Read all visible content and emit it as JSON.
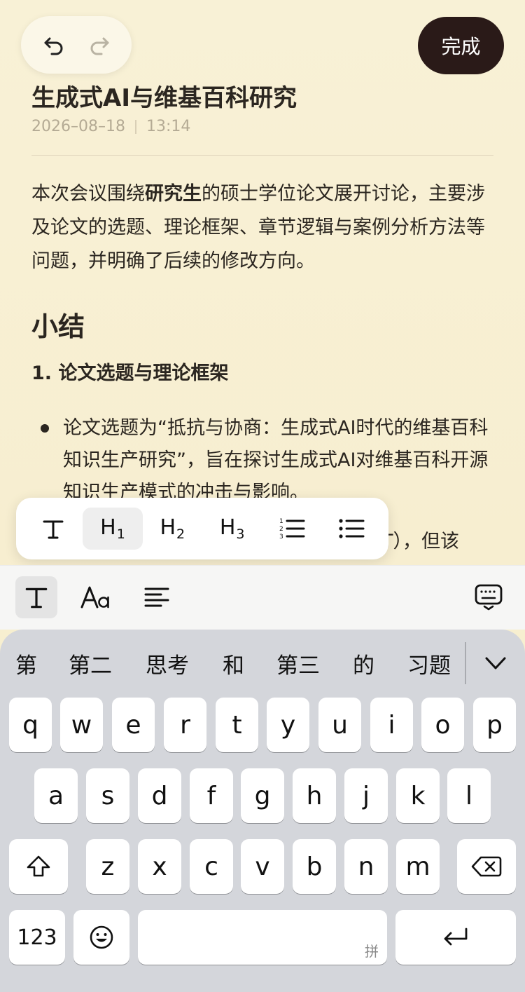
{
  "note": {
    "title": "生成式AI与维基百科研究",
    "date": "2026–08–18",
    "time": "13:14",
    "paragraph_pre": "本次会议围绕",
    "paragraph_bold": "研究生",
    "paragraph_post": "的硕士学位论文展开讨论，主要涉及论文的选题、理论框架、章节逻辑与案例分析方法等问题，并明确了后续的修改方向。",
    "heading": "小结",
    "subheading": "1. 论文选题与理论框架",
    "bullet": "论文选题为“抵抗与协商：生成式AI时代的维基百科知识生产研究”，旨在探讨生成式AI对维基百科开源知识生产模式的冲击与影响。",
    "partial_line": "T），但该"
  },
  "toolbar": {
    "done_label": "完成"
  },
  "format_popup": {
    "items": [
      {
        "name": "text-style",
        "label": "T"
      },
      {
        "name": "h1",
        "label": "H",
        "sub": "1"
      },
      {
        "name": "h2",
        "label": "H",
        "sub": "2"
      },
      {
        "name": "h3",
        "label": "H",
        "sub": "3"
      }
    ],
    "active": "h1"
  },
  "keyboard": {
    "candidates": [
      "第",
      "第二",
      "思考",
      "和",
      "第三",
      "的",
      "习题"
    ],
    "row1": [
      "q",
      "w",
      "e",
      "r",
      "t",
      "y",
      "u",
      "i",
      "o",
      "p"
    ],
    "row2": [
      "a",
      "s",
      "d",
      "f",
      "g",
      "h",
      "j",
      "k",
      "l"
    ],
    "row3": [
      "z",
      "x",
      "c",
      "v",
      "b",
      "n",
      "m"
    ],
    "numbers_label": "123",
    "space_hint": "拼"
  },
  "colors": {
    "background": "#f7efd0",
    "done_button": "#2a1a18",
    "keyboard": "#d4d6db"
  }
}
